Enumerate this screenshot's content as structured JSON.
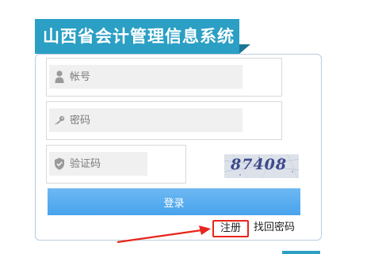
{
  "header": {
    "title": "山西省会计管理信息系统"
  },
  "login_form": {
    "username": {
      "placeholder": "帐号",
      "icon": "user-icon"
    },
    "password": {
      "placeholder": "密码",
      "icon": "key-icon"
    },
    "captcha": {
      "placeholder": "验证码",
      "icon": "shield-icon",
      "image_text": "87408"
    },
    "login_button_label": "登录",
    "register_link_label": "注册",
    "forgot_password_label": "找回密码"
  },
  "colors": {
    "brand": "#2b9fc4",
    "button": "#5aaef0",
    "highlight": "#e8261c"
  }
}
